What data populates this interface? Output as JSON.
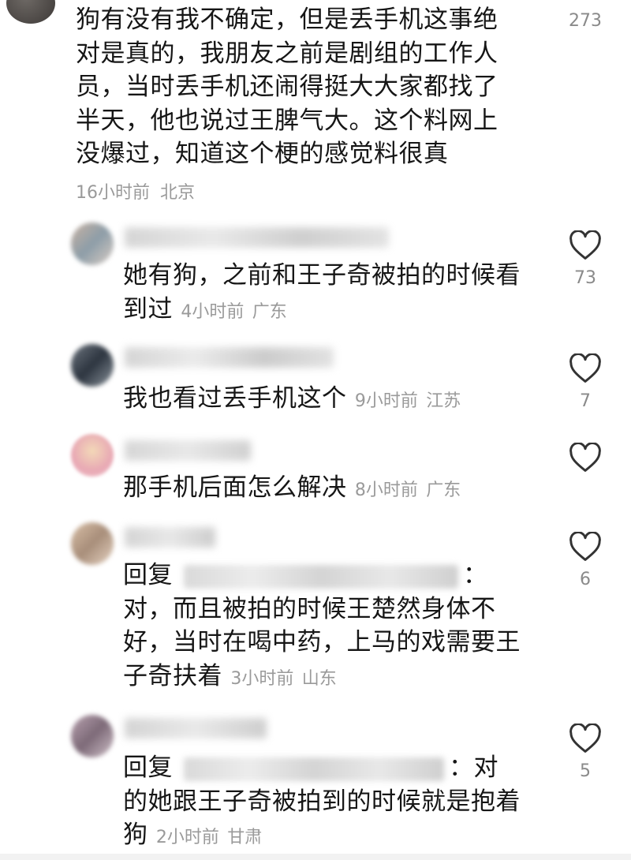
{
  "top_comment": {
    "lines": [
      "狗有没有我不确定，但是丢手机这事绝",
      "对是真的，我朋友之前是剧组的工作人",
      "员，当时丢手机还闹得挺大大家都找了",
      "半天，他也说过王脾气大。这个料网上",
      "没爆过，知道这个梗的感觉料很真"
    ],
    "time": "16小时前",
    "location": "北京",
    "likes": "273"
  },
  "replies": [
    {
      "lines": [
        "她有狗，之前和王子奇被拍的时候看",
        "到过"
      ],
      "time": "4小时前",
      "location": "广东",
      "likes": "73"
    },
    {
      "lines": [
        "我也看过丢手机这个"
      ],
      "time": "9小时前",
      "location": "江苏",
      "likes": "7"
    },
    {
      "lines": [
        "那手机后面怎么解决"
      ],
      "time": "8小时前",
      "location": "广东",
      "likes": ""
    },
    {
      "reply_prefix": "回复",
      "reply_suffix": "：",
      "lines": [
        "对，而且被拍的时候王楚然身体不",
        "好，当时在喝中药，上马的戏需要王",
        "子奇扶着"
      ],
      "time": "3小时前",
      "location": "山东",
      "likes": "6"
    },
    {
      "reply_prefix": "回复",
      "reply_suffix": "：对",
      "lines": [
        "的她跟王子奇被拍到的时候就是抱着",
        "狗"
      ],
      "time": "2小时前",
      "location": "甘肃",
      "likes": "5"
    }
  ],
  "icons": {
    "like": "heart-outline-icon"
  },
  "colors": {
    "text": "#161616",
    "meta": "#9a9a9a",
    "icon": "#333333"
  }
}
